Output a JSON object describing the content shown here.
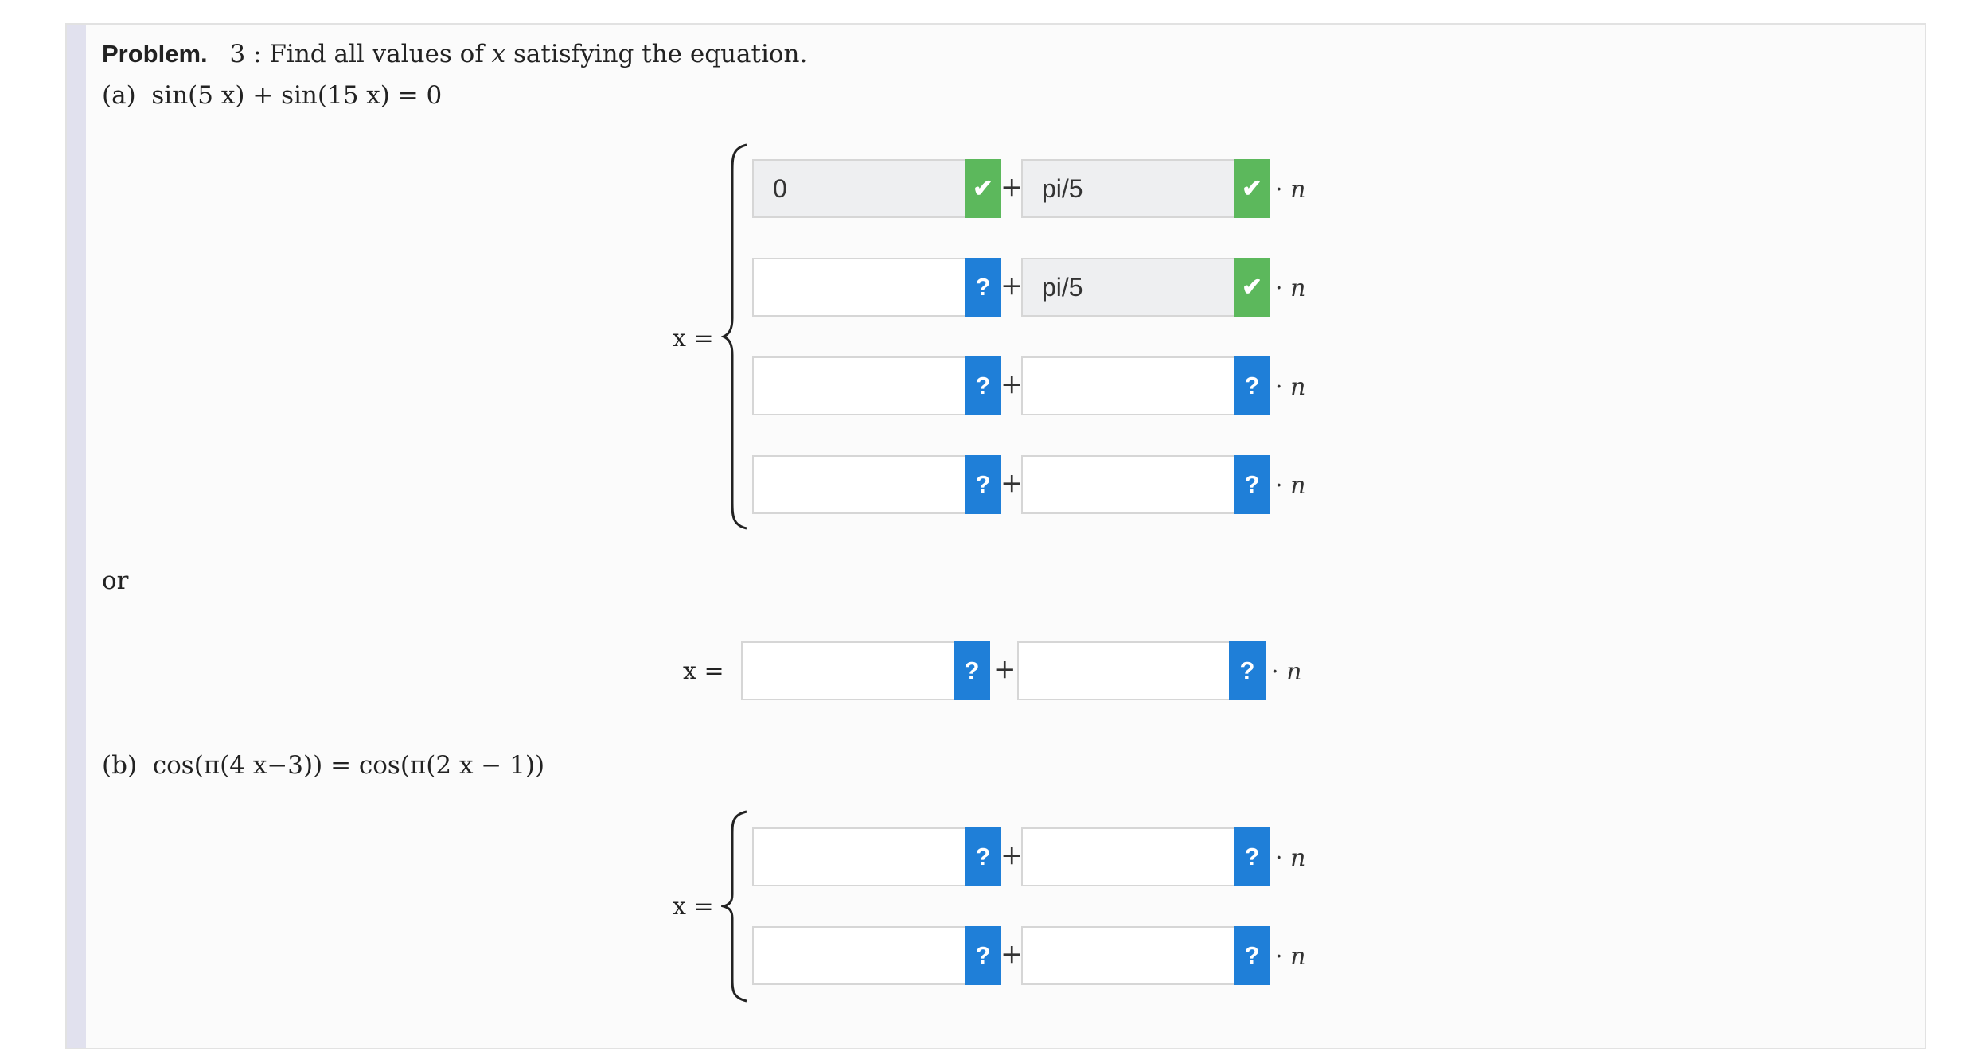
{
  "problem": {
    "label": "Problem.",
    "number": "3",
    "colon": ":",
    "text": "Find all values of",
    "var": "x",
    "text2": "satisfying the equation."
  },
  "part_a": {
    "label": "(a)",
    "equation": "sin(5 x) + sin(15 x) = 0",
    "x_eq": "x =",
    "rows": [
      {
        "c1": "0",
        "c1_status": "correct",
        "c2": "pi/5",
        "c2_status": "correct"
      },
      {
        "c1": "",
        "c1_status": "unanswered",
        "c2": "pi/5",
        "c2_status": "correct"
      },
      {
        "c1": "",
        "c1_status": "unanswered",
        "c2": "",
        "c2_status": "unanswered"
      },
      {
        "c1": "",
        "c1_status": "unanswered",
        "c2": "",
        "c2_status": "unanswered"
      }
    ]
  },
  "or_label": "or",
  "part_a_extra": {
    "x_eq": "x =",
    "c1": "",
    "c2": ""
  },
  "part_b": {
    "label": "(b)",
    "equation": "cos(π(4 x−3)) = cos(π(2 x − 1))",
    "x_eq": "x =",
    "rows": [
      {
        "c1": "",
        "c2": ""
      },
      {
        "c1": "",
        "c2": ""
      }
    ]
  },
  "symbols": {
    "plus": "+",
    "times_n": "· n",
    "question": "?",
    "check": "✔"
  },
  "colors": {
    "unanswered_badge": "#1f7fd8",
    "correct_badge": "#5cb85c",
    "side_stripe": "#e1e1ee"
  }
}
